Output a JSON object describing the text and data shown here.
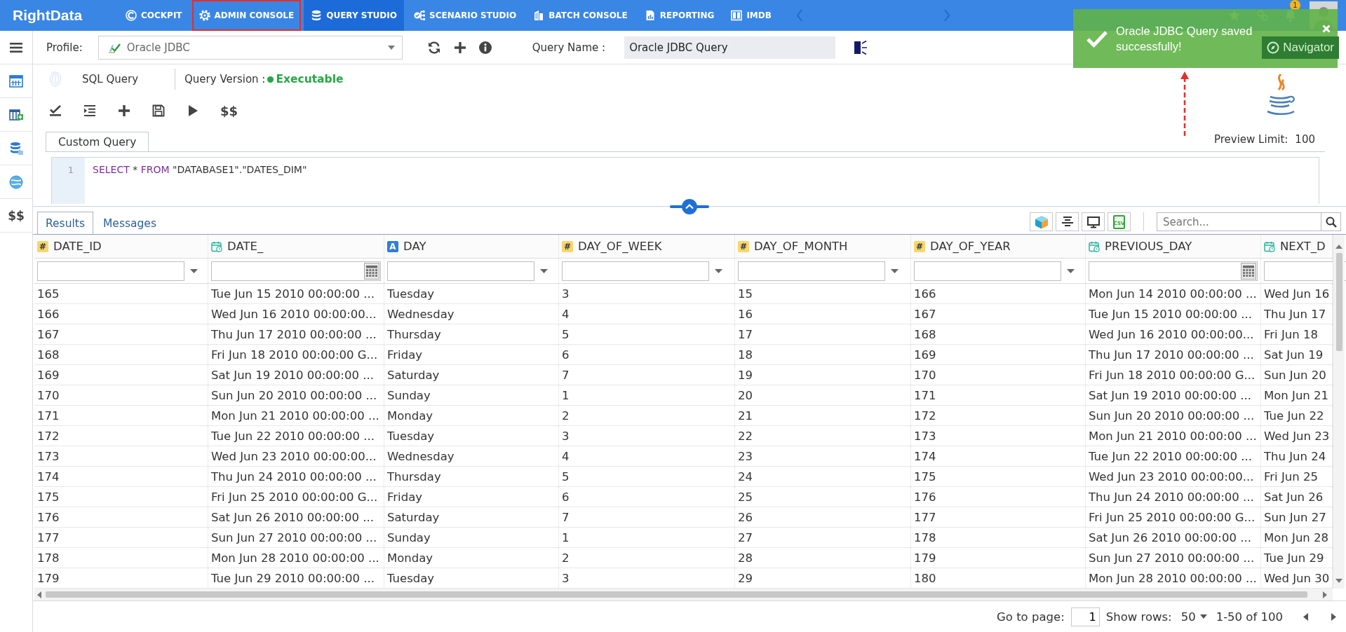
{
  "top_nav": {
    "logo": "RightData",
    "items": [
      {
        "label": "COCKPIT",
        "selected": false,
        "highlighted": false
      },
      {
        "label": "ADMIN CONSOLE",
        "selected": false,
        "highlighted": true
      },
      {
        "label": "QUERY STUDIO",
        "selected": true,
        "highlighted": false
      },
      {
        "label": "SCENARIO STUDIO",
        "selected": false,
        "highlighted": false
      },
      {
        "label": "BATCH CONSOLE",
        "selected": false,
        "highlighted": false
      },
      {
        "label": "REPORTING",
        "selected": false,
        "highlighted": false
      },
      {
        "label": "IMDB",
        "selected": false,
        "highlighted": false
      }
    ],
    "notification_count": "1"
  },
  "toast": {
    "message": "Oracle JDBC Query saved successfully!",
    "annotation_arrow": true
  },
  "sidebar": {
    "text_item": "$$"
  },
  "profile_bar": {
    "profile_label": "Profile:",
    "profile": "Oracle JDBC",
    "query_name_label": "Query Name :",
    "query_name": "Oracle JDBC Query",
    "navigator_button": "Navigator"
  },
  "query_header": {
    "title": "SQL Query",
    "version_label": "Query Version :",
    "version_status": "Executable"
  },
  "editor_toolbar": {
    "text_button": "$$"
  },
  "query_tabs": [
    {
      "label": "Custom Query",
      "selected": true
    }
  ],
  "preview_limit": {
    "label": "Preview Limit:",
    "value": "100"
  },
  "editor": {
    "lines": [
      {
        "number": "1",
        "tokens": [
          {
            "kind": "keyword",
            "text": "SELECT"
          },
          {
            "kind": "plain",
            "text": " * "
          },
          {
            "kind": "keyword",
            "text": "FROM"
          },
          {
            "kind": "plain",
            "text": " \"DATABASE1\".\"DATES_DIM\""
          }
        ]
      }
    ]
  },
  "results": {
    "tabs": [
      {
        "label": "Results",
        "selected": true
      },
      {
        "label": "Messages",
        "selected": false
      }
    ],
    "export_label": "CSV",
    "search_placeholder": "Search..."
  },
  "table": {
    "columns": [
      {
        "name": "DATE_ID",
        "kind": "number",
        "symbol": "#"
      },
      {
        "name": "DATE_",
        "kind": "date"
      },
      {
        "name": "DAY",
        "kind": "text",
        "symbol": "A"
      },
      {
        "name": "DAY_OF_WEEK",
        "kind": "number",
        "symbol": "#"
      },
      {
        "name": "DAY_OF_MONTH",
        "kind": "number",
        "symbol": "#"
      },
      {
        "name": "DAY_OF_YEAR",
        "kind": "number",
        "symbol": "#"
      },
      {
        "name": "PREVIOUS_DAY",
        "kind": "date"
      },
      {
        "name": "NEXT_D",
        "kind": "date"
      }
    ],
    "rows": [
      [
        "165",
        "Tue Jun 15 2010 00:00:00 ...",
        "Tuesday",
        "3",
        "15",
        "166",
        "Mon Jun 14 2010 00:00:00 ...",
        "Wed Jun 16"
      ],
      [
        "166",
        "Wed Jun 16 2010 00:00:00...",
        "Wednesday",
        "4",
        "16",
        "167",
        "Tue Jun 15 2010 00:00:00 ...",
        "Thu Jun 17"
      ],
      [
        "167",
        "Thu Jun 17 2010 00:00:00 ...",
        "Thursday",
        "5",
        "17",
        "168",
        "Wed Jun 16 2010 00:00:00...",
        "Fri Jun 18"
      ],
      [
        "168",
        "Fri Jun 18 2010 00:00:00 G...",
        "Friday",
        "6",
        "18",
        "169",
        "Thu Jun 17 2010 00:00:00 ...",
        "Sat Jun 19"
      ],
      [
        "169",
        "Sat Jun 19 2010 00:00:00 ...",
        "Saturday",
        "7",
        "19",
        "170",
        "Fri Jun 18 2010 00:00:00 G...",
        "Sun Jun 20"
      ],
      [
        "170",
        "Sun Jun 20 2010 00:00:00 ...",
        "Sunday",
        "1",
        "20",
        "171",
        "Sat Jun 19 2010 00:00:00 ...",
        "Mon Jun 21"
      ],
      [
        "171",
        "Mon Jun 21 2010 00:00:00 ...",
        "Monday",
        "2",
        "21",
        "172",
        "Sun Jun 20 2010 00:00:00 ...",
        "Tue Jun 22"
      ],
      [
        "172",
        "Tue Jun 22 2010 00:00:00 ...",
        "Tuesday",
        "3",
        "22",
        "173",
        "Mon Jun 21 2010 00:00:00 ...",
        "Wed Jun 23"
      ],
      [
        "173",
        "Wed Jun 23 2010 00:00:00...",
        "Wednesday",
        "4",
        "23",
        "174",
        "Tue Jun 22 2010 00:00:00 ...",
        "Thu Jun 24"
      ],
      [
        "174",
        "Thu Jun 24 2010 00:00:00 ...",
        "Thursday",
        "5",
        "24",
        "175",
        "Wed Jun 23 2010 00:00:00...",
        "Fri Jun 25"
      ],
      [
        "175",
        "Fri Jun 25 2010 00:00:00 G...",
        "Friday",
        "6",
        "25",
        "176",
        "Thu Jun 24 2010 00:00:00 ...",
        "Sat Jun 26"
      ],
      [
        "176",
        "Sat Jun 26 2010 00:00:00 ...",
        "Saturday",
        "7",
        "26",
        "177",
        "Fri Jun 25 2010 00:00:00 G...",
        "Sun Jun 27"
      ],
      [
        "177",
        "Sun Jun 27 2010 00:00:00 ...",
        "Sunday",
        "1",
        "27",
        "178",
        "Sat Jun 26 2010 00:00:00 ...",
        "Mon Jun 28"
      ],
      [
        "178",
        "Mon Jun 28 2010 00:00:00 ...",
        "Monday",
        "2",
        "28",
        "179",
        "Sun Jun 27 2010 00:00:00 ...",
        "Tue Jun 29"
      ],
      [
        "179",
        "Tue Jun 29 2010 00:00:00 ...",
        "Tuesday",
        "3",
        "29",
        "180",
        "Mon Jun 28 2010 00:00:00 ...",
        "Wed Jun 30"
      ]
    ]
  },
  "pagination": {
    "go_to_page_label": "Go to page:",
    "page": "1",
    "show_rows_label": "Show rows:",
    "rows_per_page": "50",
    "range": "1-50 of 100"
  }
}
